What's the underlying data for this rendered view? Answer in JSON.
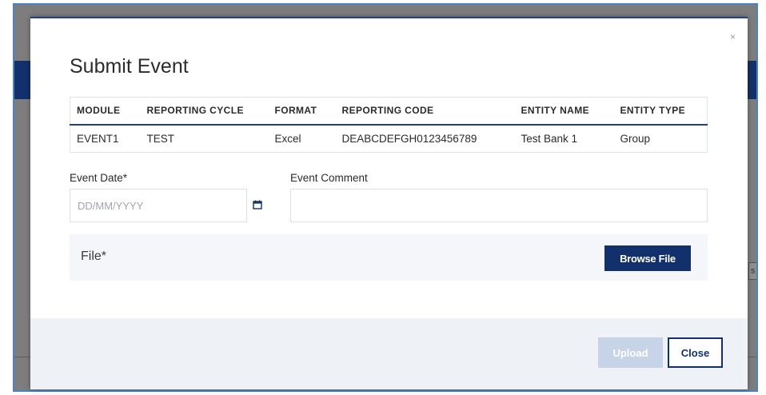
{
  "modal": {
    "title": "Submit Event",
    "close_glyph": "×"
  },
  "table": {
    "headers": [
      "MODULE",
      "REPORTING CYCLE",
      "FORMAT",
      "REPORTING CODE",
      "ENTITY NAME",
      "ENTITY TYPE"
    ],
    "rows": [
      [
        "EVENT1",
        "TEST",
        "Excel",
        "DEABCDEFGH0123456789",
        "Test Bank 1",
        "Group"
      ]
    ]
  },
  "form": {
    "event_date_label": "Event Date",
    "event_date_required": "*",
    "event_date_placeholder": "DD/MM/YYYY",
    "event_date_value": "",
    "event_comment_label": "Event Comment",
    "event_comment_value": "",
    "file_label": "File*",
    "browse_label": "Browse File"
  },
  "footer": {
    "upload_label": "Upload",
    "close_label": "Close"
  },
  "colors": {
    "primary": "#12306b",
    "disabled_button": "#c7d3e6",
    "overlay": "#7d7d7d"
  },
  "icons": {
    "calendar": "calendar-icon"
  }
}
